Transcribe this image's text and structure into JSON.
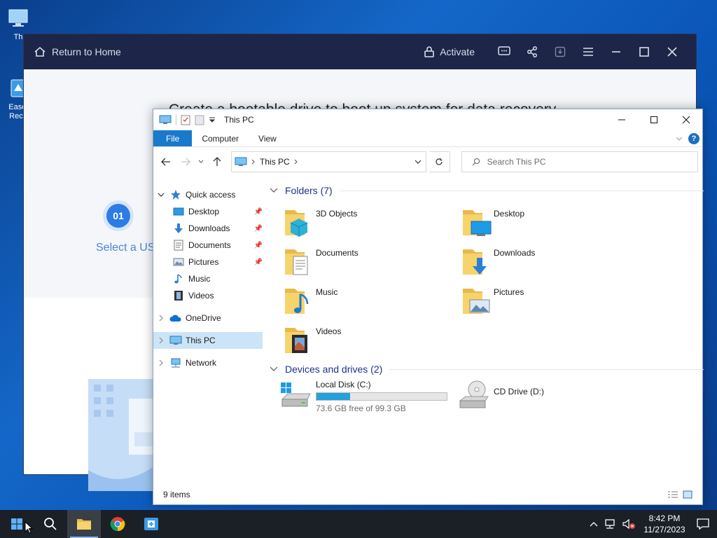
{
  "desktop": {
    "icons": [
      {
        "label": "Th"
      },
      {
        "label": "Easel\nReco"
      }
    ]
  },
  "app": {
    "home_label": "Return to Home",
    "activate_label": "Activate",
    "title": "Create a bootable drive to boot up system for data recovery",
    "step_number": "01",
    "step_label": "Select a US"
  },
  "explorer": {
    "title": "This PC",
    "ribbon_tabs": [
      "File",
      "Computer",
      "View"
    ],
    "address": "This PC",
    "search_placeholder": "Search This PC",
    "nav": {
      "quick_access": "Quick access",
      "items": [
        "Desktop",
        "Downloads",
        "Documents",
        "Pictures",
        "Music",
        "Videos"
      ],
      "onedrive": "OneDrive",
      "this_pc": "This PC",
      "network": "Network"
    },
    "folders_header": "Folders (7)",
    "folders": [
      "3D Objects",
      "Desktop",
      "Documents",
      "Downloads",
      "Music",
      "Pictures",
      "Videos"
    ],
    "devices_header": "Devices and drives (2)",
    "drives": [
      {
        "name": "Local Disk (C:)",
        "free": "73.6 GB free of 99.3 GB",
        "used_fraction": 0.259
      },
      {
        "name": "CD Drive (D:)"
      }
    ],
    "status": "9 items"
  },
  "taskbar": {
    "time": "8:42 PM",
    "date": "11/27/2023"
  },
  "colors": {
    "accent": "#1979ca",
    "app_bar": "#1d2648",
    "folder": "#f6d36b",
    "drive_bar": "#26a0da"
  }
}
